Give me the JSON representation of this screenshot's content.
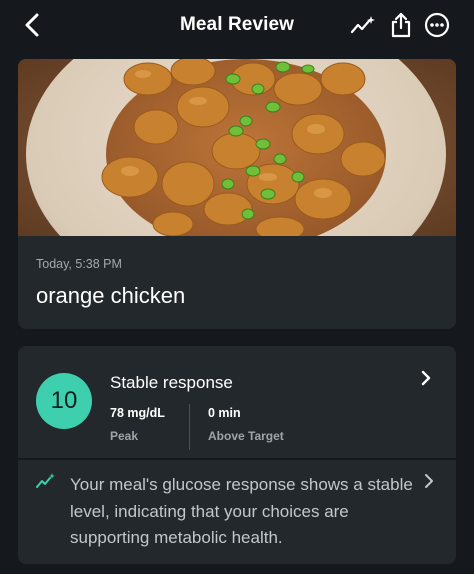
{
  "header": {
    "title": "Meal Review",
    "back_icon": "chevron-left-icon",
    "trend_icon": "trend-sparkle-icon",
    "share_icon": "share-icon",
    "more_icon": "more-circle-icon"
  },
  "meal": {
    "timestamp": "Today, 5:38 PM",
    "name": "orange chicken",
    "photo": "meal-photo"
  },
  "response": {
    "score": "10",
    "title": "Stable response",
    "peak_value": "78  mg/dL",
    "peak_label": "Peak",
    "above_value": "0  min",
    "above_label": "Above Target"
  },
  "insight": {
    "text": "Your meal's glucose response shows a stable level, indicating that your choices are supporting metabolic health."
  },
  "colors": {
    "background": "#15191d",
    "card": "#23282d",
    "accent": "#3ecfae",
    "muted_text": "#a4a9ae"
  }
}
